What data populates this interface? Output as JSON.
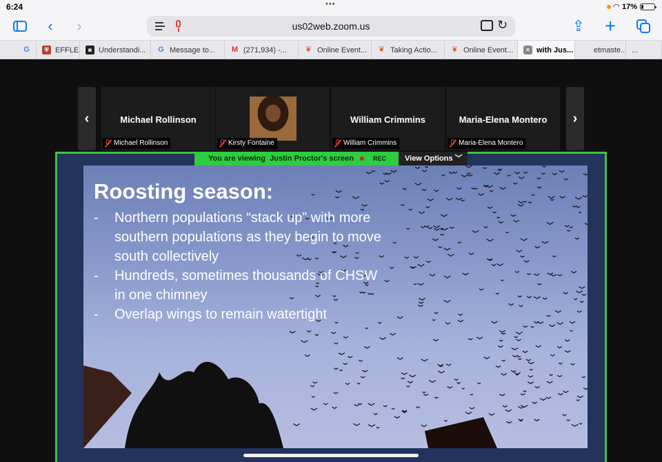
{
  "status": {
    "time": "6:24",
    "battery": "17%",
    "battery_level": 0.17
  },
  "browser": {
    "url": "us02web.zoom.us",
    "tabs": [
      {
        "label": "",
        "icon": "google-icon",
        "glyph": "G",
        "fav": "g"
      },
      {
        "label": "EFFLEU",
        "icon": "shield-icon",
        "glyph": "⛨",
        "fav": "shield"
      },
      {
        "label": "Understandi...",
        "icon": "dark-logo-icon",
        "glyph": "◙",
        "fav": "dark"
      },
      {
        "label": "Message to...",
        "icon": "google-icon",
        "glyph": "G",
        "fav": "g"
      },
      {
        "label": "(271,934) -...",
        "icon": "gmail-icon",
        "glyph": "M",
        "fav": "gm"
      },
      {
        "label": "Online Event...",
        "icon": "flame-icon",
        "glyph": "❦",
        "fav": "flame"
      },
      {
        "label": "Taking Actio...",
        "icon": "flame-icon",
        "glyph": "❦",
        "fav": "flame"
      },
      {
        "label": "Online Event...",
        "icon": "flame-icon",
        "glyph": "❦",
        "fav": "flame"
      },
      {
        "label": "with Jus...",
        "icon": "close-tab-icon",
        "glyph": "×",
        "fav": "zx",
        "active": true
      },
      {
        "label": "etmaste...",
        "icon": "mic-icon",
        "glyph": "",
        "fav": ""
      },
      {
        "label": "...",
        "icon": "",
        "glyph": "",
        "fav": ""
      }
    ]
  },
  "meeting": {
    "participants": [
      {
        "name": "Michael Rollinson",
        "label": "Michael Rollinson",
        "has_video": false
      },
      {
        "name": "",
        "label": "Kirsty Fontaine",
        "has_video": true
      },
      {
        "name": "William Crimmins",
        "label": "William Crimmins",
        "has_video": false
      },
      {
        "name": "Maria-Elena Montero",
        "label": "Maria-Elena Montero",
        "has_video": false
      }
    ],
    "share_banner_prefix": "You are viewing",
    "share_banner_presenter": "Justin Proctor's screen",
    "rec_label": "REC",
    "view_options": "View Options"
  },
  "slide": {
    "title": "Roosting season:",
    "bullets": [
      {
        "dash": "-",
        "text": "Northern populations “stack up” with more southern populations as they begin to move south collectively"
      },
      {
        "dash": "-",
        "text": "Hundreds, sometimes thousands of CHSW in one chimney"
      },
      {
        "dash": "-",
        "text": "Overlap wings to remain watertight"
      }
    ]
  }
}
